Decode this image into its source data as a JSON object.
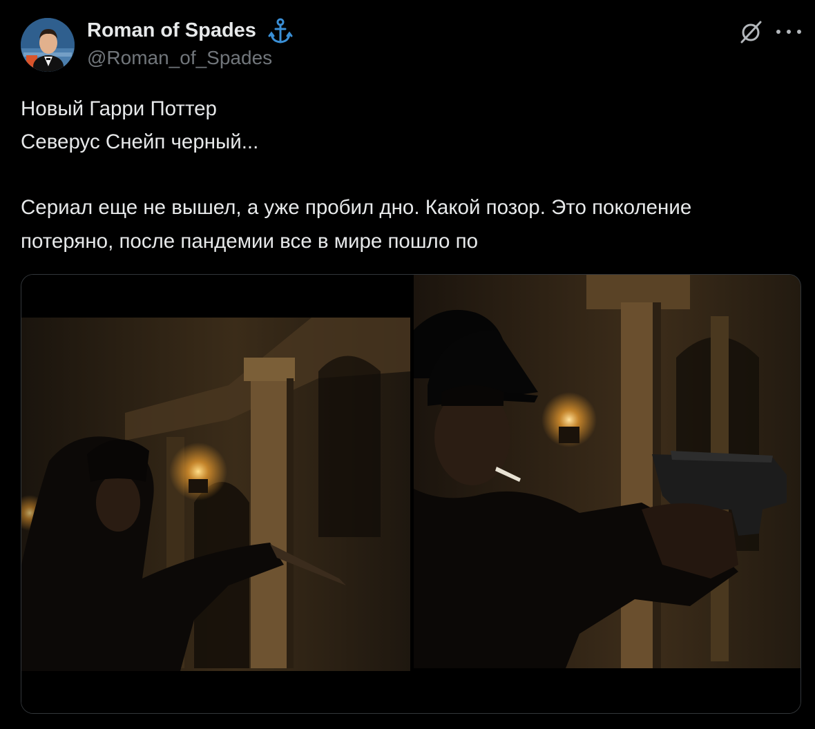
{
  "author": {
    "display_name": "Roman of Spades",
    "handle": "@Roman_of_Spades",
    "badge_icon": "anchor-icon",
    "badge_color": "#3a8fd6"
  },
  "actions": {
    "grok_icon": "slashed-circle-icon",
    "more_icon": "more-dots-icon"
  },
  "post": {
    "lines": [
      "Новый Гарри Поттер",
      "Северус Снейп черный...",
      "Сериал еще не вышел, а уже пробил дно. Какой позор. Это поколение",
      "потеряно, после пандемии все в мире пошло по"
    ]
  },
  "media": {
    "frames": 2
  },
  "colors": {
    "background": "#000000",
    "text": "#e7e9ea",
    "secondary": "#71767b",
    "border": "#33373b"
  }
}
